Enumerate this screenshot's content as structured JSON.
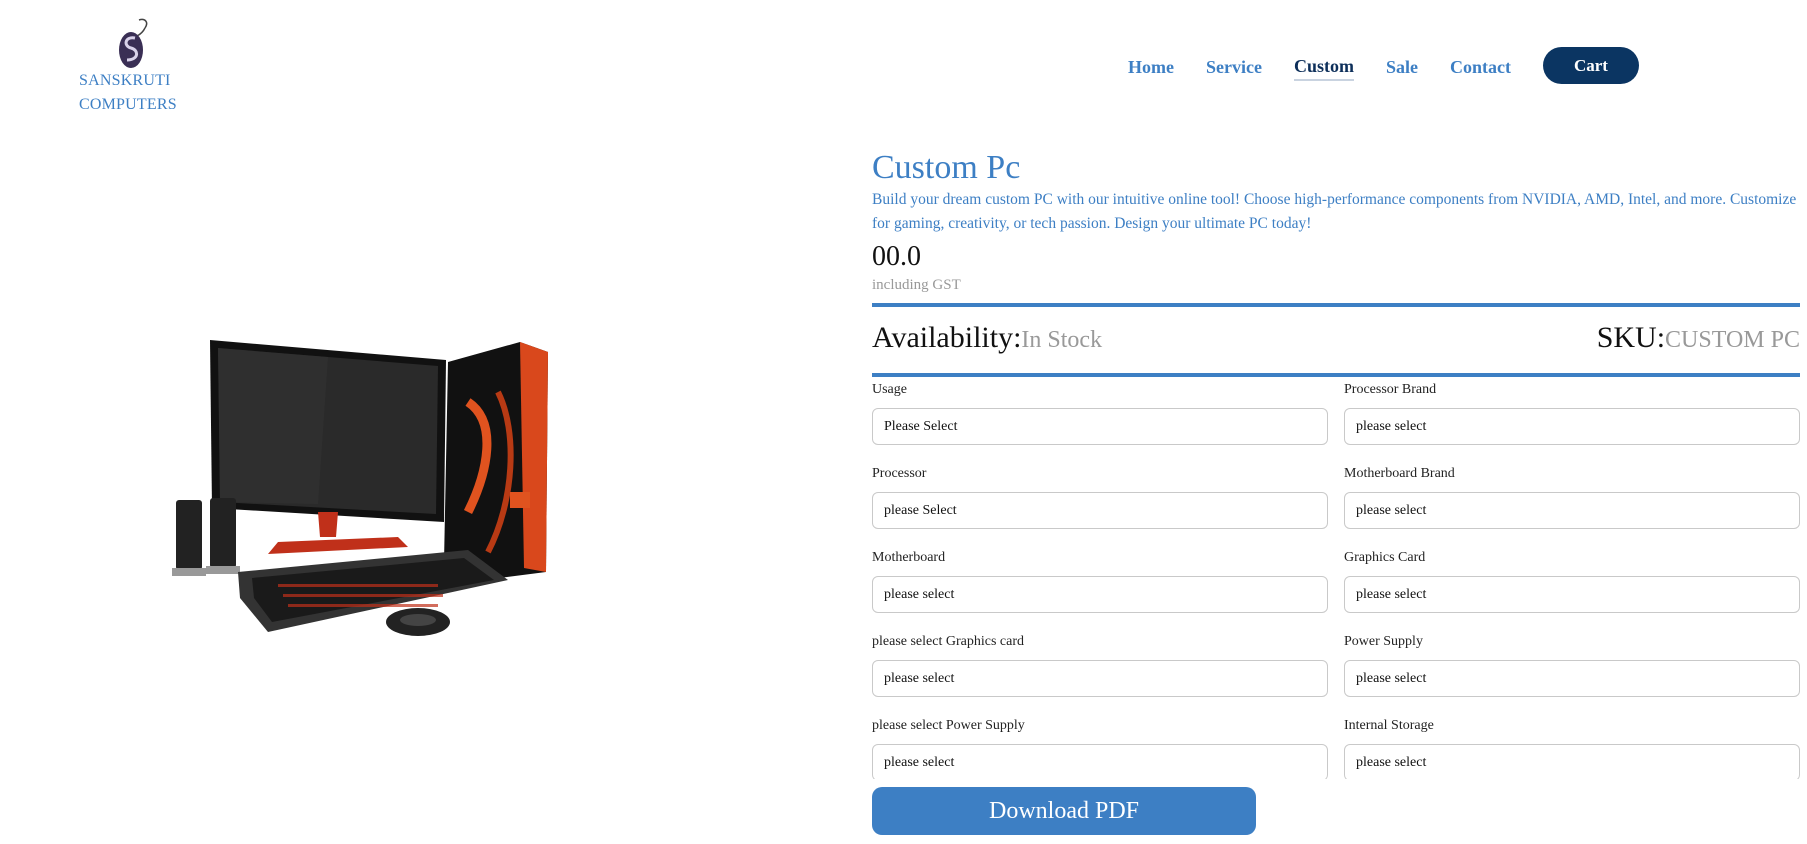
{
  "brand": {
    "logo_icon": "mouse-s-logo-icon",
    "name_line1": "SANSKRUTI",
    "name_line2": "COMPUTERS"
  },
  "nav": {
    "items": [
      {
        "label": "Home"
      },
      {
        "label": "Service"
      },
      {
        "label": "Custom",
        "active": true
      },
      {
        "label": "Sale"
      },
      {
        "label": "Contact"
      }
    ],
    "cart_label": "Cart"
  },
  "product": {
    "image": "gaming-pc-setup-image",
    "title": "Custom Pc",
    "description": "Build your dream custom PC with our intuitive online tool! Choose high-performance components from NVIDIA, AMD, Intel, and more. Customize for gaming, creativity, or tech passion. Design your ultimate PC today!",
    "price": "00.0",
    "price_note": "including GST",
    "availability_label": "Availability:",
    "availability_value": "In Stock",
    "sku_label": "SKU:",
    "sku_value": "CUSTOM PC"
  },
  "form": {
    "fields": [
      {
        "label": "Usage",
        "value": "Please Select"
      },
      {
        "label": "Processor Brand",
        "value": "please select"
      },
      {
        "label": "Processor",
        "value": "please Select"
      },
      {
        "label": "Motherboard Brand",
        "value": "please select"
      },
      {
        "label": "Motherboard",
        "value": "please select"
      },
      {
        "label": "Graphics Card",
        "value": "please select"
      },
      {
        "label": "please select Graphics card",
        "value": "please select"
      },
      {
        "label": "Power Supply",
        "value": "please select"
      },
      {
        "label": "please select Power Supply",
        "value": "please select"
      },
      {
        "label": "Internal Storage",
        "value": "please select"
      }
    ]
  },
  "download_label": "Download PDF",
  "colors": {
    "accent": "#3d7fc4",
    "nav_dark": "#0b3562",
    "muted": "#999999"
  }
}
